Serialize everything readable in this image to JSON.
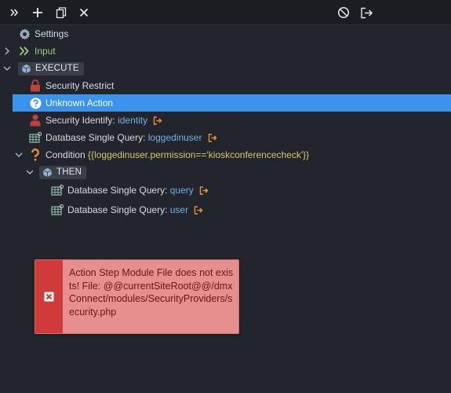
{
  "toolbar": {
    "left_buttons": [
      {
        "icon": "expand-chevrons-icon"
      },
      {
        "icon": "plus-icon"
      },
      {
        "icon": "copy-icon"
      },
      {
        "icon": "close-icon"
      }
    ],
    "right_buttons": [
      {
        "icon": "disable-icon"
      },
      {
        "icon": "export-icon"
      }
    ]
  },
  "tree": {
    "settings": {
      "label": "Settings"
    },
    "input": {
      "label": "Input"
    },
    "execute": {
      "label": "EXECUTE"
    },
    "security_restrict": {
      "label": "Security Restrict"
    },
    "unknown_action": {
      "label": "Unknown Action"
    },
    "security_identify": {
      "label": "Security Identify:",
      "value": "identity"
    },
    "db_query_loggedinuser": {
      "label": "Database Single Query:",
      "value": "loggedinuser"
    },
    "condition": {
      "label": "Condition",
      "expression": "{{loggedinuser.permission=='kioskconferencecheck'}}"
    },
    "then": {
      "label": "THEN"
    },
    "db_query_query": {
      "label": "Database Single Query:",
      "value": "query"
    },
    "db_query_user": {
      "label": "Database Single Query:",
      "value": "user"
    }
  },
  "error": {
    "message": "Action Step Module File does not exists! File: @@currentSiteRoot@@/dmxConnect/modules/SecurityProviders/security.php"
  },
  "colors": {
    "background": "#22252b",
    "selected": "#3b93ec",
    "value_text": "#6fb3ec",
    "condition_text": "#d7c76c",
    "error_bg": "#e78e8e",
    "error_accent": "#d03a3a"
  }
}
